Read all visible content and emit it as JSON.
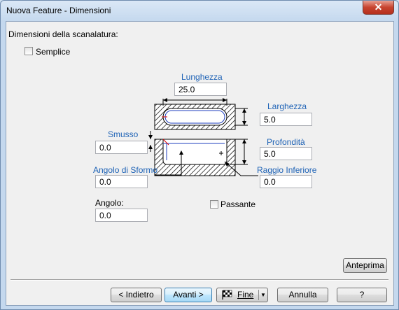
{
  "window": {
    "title": "Nuova Feature - Dimensioni",
    "close_glyph": "✕"
  },
  "section": {
    "heading": "Dimensioni della scanalatura:"
  },
  "options": {
    "semplice": "Semplice",
    "passante": "Passante"
  },
  "fields": {
    "lunghezza": {
      "label": "Lunghezza",
      "value": "25.0"
    },
    "larghezza": {
      "label": "Larghezza",
      "value": "5.0"
    },
    "profondita": {
      "label": "Profondità",
      "value": "5.0"
    },
    "smusso": {
      "label": "Smusso",
      "value": "0.0"
    },
    "angolo_sformo": {
      "label": "Angolo di Sformo",
      "value": "0.0"
    },
    "raggio_inferiore": {
      "label": "Raggio Inferiore",
      "value": "0.0"
    },
    "angolo": {
      "label": "Angolo:",
      "value": "0.0"
    }
  },
  "buttons": {
    "anteprima": "Anteprima",
    "indietro": "< Indietro",
    "avanti": "Avanti >",
    "fine": "Fine",
    "annulla": "Annulla",
    "help": "?"
  },
  "icons": {
    "fine": "checkered-flag-icon",
    "split": "dropdown-arrow-icon",
    "close": "close-icon"
  }
}
